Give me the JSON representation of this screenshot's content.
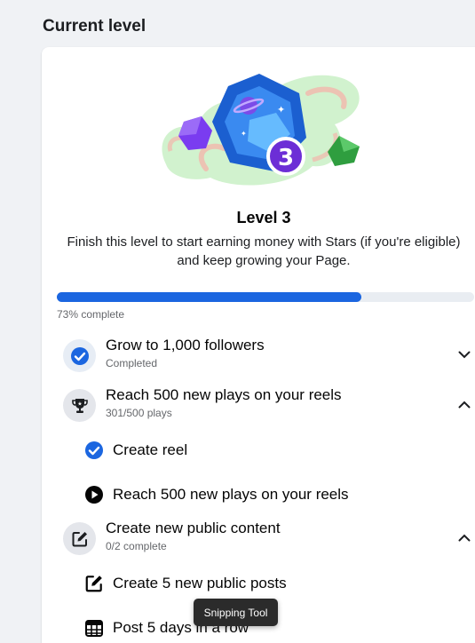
{
  "header": {
    "section_title": "Current level"
  },
  "level": {
    "title": "Level 3",
    "badge_number": "3",
    "description": "Finish this level to start earning money with Stars (if you're eligible) and keep growing your Page.",
    "progress_fraction": 0.73,
    "progress_label": "73% complete"
  },
  "tasks": [
    {
      "title": "Grow to 1,000 followers",
      "subtitle": "Completed",
      "icon": "checkmark-circle-icon",
      "expanded": false
    },
    {
      "title": "Reach 500 new plays on your reels",
      "subtitle": "301/500 plays",
      "icon": "trophy-icon",
      "expanded": true,
      "subtasks": [
        {
          "label": "Create reel",
          "icon": "checkmark-circle-icon"
        },
        {
          "label": "Reach 500 new plays on your reels",
          "icon": "play-circle-icon"
        }
      ]
    },
    {
      "title": "Create new public content",
      "subtitle": "0/2 complete",
      "icon": "edit-icon",
      "expanded": true,
      "subtasks": [
        {
          "label": "Create 5 new public posts",
          "icon": "edit-icon"
        },
        {
          "label": "Post 5 days in a row",
          "icon": "calendar-icon"
        }
      ]
    }
  ],
  "tooltip": {
    "text": "Snipping Tool"
  },
  "colors": {
    "accent": "#1b66e0",
    "track": "#e9edf2",
    "badge": "#6c2ed6"
  }
}
